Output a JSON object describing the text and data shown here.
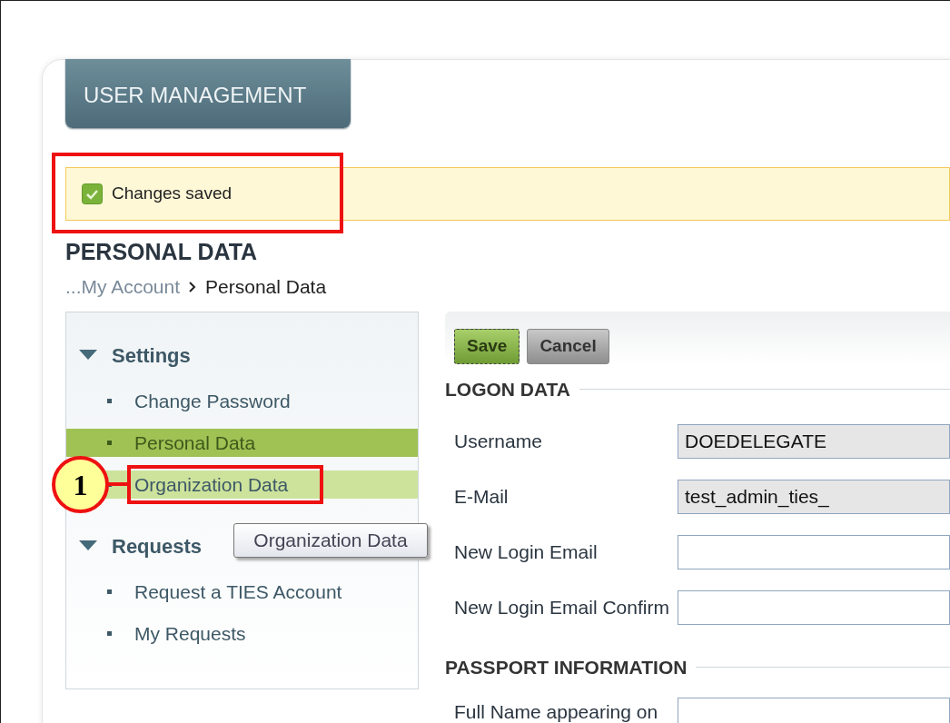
{
  "header_tab": {
    "label": "USER MANAGEMENT"
  },
  "notice": {
    "text": "Changes saved"
  },
  "page_title": "PERSONAL DATA",
  "breadcrumb": [
    {
      "label": "...My Account",
      "kind": "link"
    },
    {
      "label": "Personal Data",
      "kind": "current"
    }
  ],
  "sidebar": {
    "sections": [
      {
        "label": "Settings",
        "expanded": true,
        "items": [
          {
            "label": "Change Password",
            "selected": false,
            "hovered": false
          },
          {
            "label": "Personal Data",
            "selected": true,
            "hovered": false
          },
          {
            "label": "Organization Data",
            "selected": false,
            "hovered": true
          }
        ]
      },
      {
        "label": "Requests",
        "expanded": true,
        "items": [
          {
            "label": "Request a TIES Account",
            "selected": false,
            "hovered": false
          },
          {
            "label": "My Requests",
            "selected": false,
            "hovered": false
          }
        ]
      }
    ]
  },
  "tooltip": "Organization Data",
  "callout": {
    "number": "1"
  },
  "toolbar": [
    {
      "label": "Save",
      "kind": "primary"
    },
    {
      "label": "Cancel",
      "kind": "secondary"
    }
  ],
  "sections": [
    {
      "title": "LOGON DATA",
      "fields": [
        {
          "label": "Username",
          "value": "DOEDELEGATE",
          "disabled": true
        },
        {
          "label": "E-Mail",
          "value": "test_admin_ties_",
          "disabled": true
        },
        {
          "label": "New Login Email",
          "disabled": false
        },
        {
          "label": "New Login Email Confirm",
          "disabled": false
        }
      ]
    },
    {
      "title": "PASSPORT INFORMATION",
      "fields": [
        {
          "label": "Full Name appearing on",
          "disabled": false
        }
      ]
    }
  ]
}
